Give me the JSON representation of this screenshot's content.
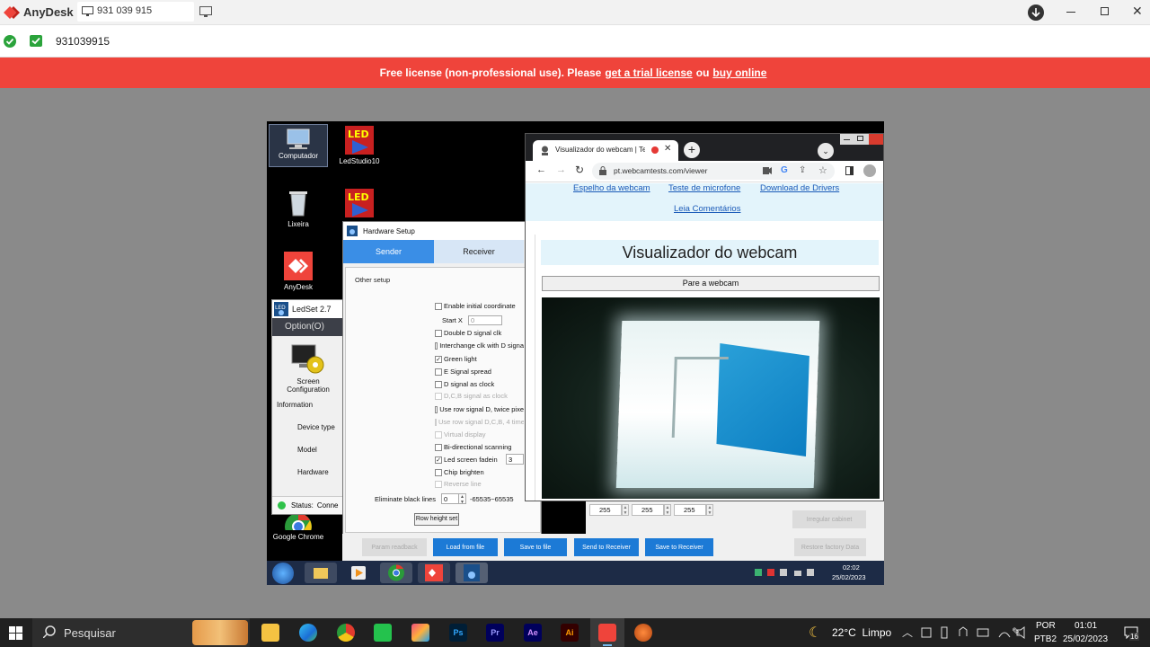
{
  "anydesk": {
    "app_name": "AnyDesk",
    "tab_label": "931 039 915",
    "address_value": "931039915",
    "banner": {
      "text_before": "Free license (non-professional use). Please",
      "trial_link": "get a trial license",
      "text_mid": "ou",
      "buy_link": "buy online"
    },
    "colors": {
      "brand": "#ef443b",
      "banner": "#ef443b"
    }
  },
  "remote_desktop": {
    "icons": [
      {
        "label": "Computador"
      },
      {
        "label": "LedStudio10"
      },
      {
        "label": "Lixeira"
      },
      {
        "label": "AnyDesk"
      },
      {
        "label": "Google Chrome"
      }
    ],
    "ledset": {
      "title": "LedSet 2.7",
      "menu": "Option(O)",
      "screen_config": "Screen Configuration",
      "information": "Information",
      "device_type": "Device type",
      "model": "Model",
      "hardware": "Hardware",
      "status": "Status:",
      "status_value": "Conne"
    },
    "hardware_setup": {
      "title": "Hardware Setup",
      "tabs": [
        "Sender",
        "Receiver"
      ],
      "group_label": "Other setup",
      "options": [
        {
          "label": "Enable initial coordinate",
          "checked": false,
          "enabled": true
        },
        {
          "label": "Double D signal clk",
          "checked": false,
          "enabled": true
        },
        {
          "label": "Interchange clk with D signa",
          "checked": false,
          "enabled": true
        },
        {
          "label": "Green light",
          "checked": true,
          "enabled": true
        },
        {
          "label": "E Signal spread",
          "checked": false,
          "enabled": true
        },
        {
          "label": "D signal as clock",
          "checked": false,
          "enabled": true
        },
        {
          "label": "D,C,B signal as clock",
          "checked": false,
          "enabled": false
        },
        {
          "label": "Use row signal D, twice pixe",
          "checked": false,
          "enabled": true
        },
        {
          "label": "Use row signal D,C,B, 4 time",
          "checked": false,
          "enabled": false
        },
        {
          "label": "Virtual display",
          "checked": false,
          "enabled": false
        },
        {
          "label": "Bi-directional scanning",
          "checked": false,
          "enabled": true
        },
        {
          "label": "Led screen fadein",
          "checked": true,
          "enabled": true
        },
        {
          "label": "Chip brighten",
          "checked": false,
          "enabled": true
        },
        {
          "label": "Reverse line",
          "checked": false,
          "enabled": false
        }
      ],
      "start_x_label": "Start X",
      "start_x_value": "0",
      "fadein_value": "3",
      "eliminate_label": "Eliminate black lines",
      "eliminate_value": "0",
      "eliminate_range": "-65535~65535",
      "row_height_button": "Row height set",
      "rgb_values": [
        "255",
        "255",
        "255"
      ],
      "irregular_cabinet": "Irregular cabinet",
      "buttons": {
        "param_readback": "Param readback",
        "load_from_file": "Load from file",
        "save_to_file": "Save to file",
        "send_to_receiver": "Send to Receiver",
        "save_to_receiver": "Save to Receiver",
        "restore_factory": "Restore factory Data"
      }
    },
    "browser": {
      "tab_title": "Visualizador do webcam | Te",
      "url": "pt.webcamtests.com/viewer",
      "links": [
        "Espelho da webcam",
        "Teste de microfone",
        "Download de Drivers"
      ],
      "comments_link": "Leia Comentários",
      "heading": "Visualizador do webcam",
      "stop_button": "Pare a webcam"
    },
    "taskbar": {
      "time": "02:02",
      "date": "25/02/2023"
    }
  },
  "host_taskbar": {
    "search_placeholder": "Pesquisar",
    "weather": "22°C  Limpo",
    "lang_top": "POR",
    "lang_bottom": "PTB2",
    "time": "01:01",
    "date": "25/02/2023",
    "notif_count": "16"
  }
}
